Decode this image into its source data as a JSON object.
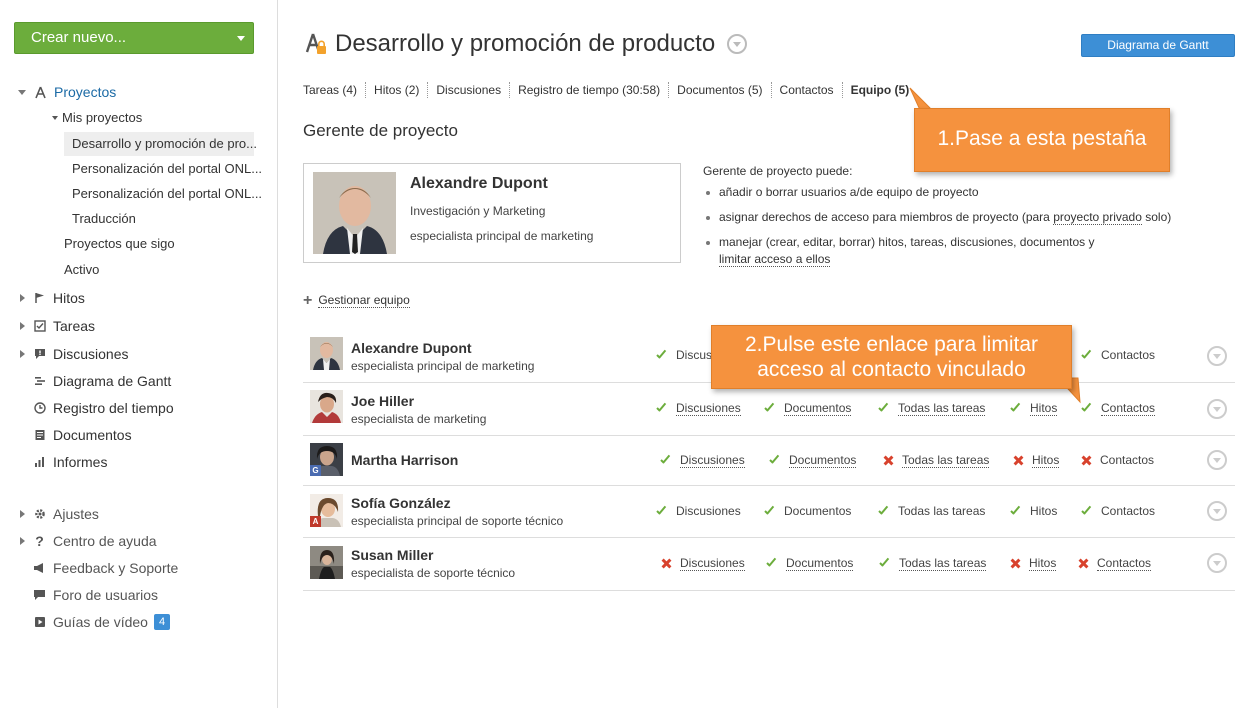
{
  "sidebar": {
    "create_label": "Crear nuevo...",
    "projects_label": "Proyectos",
    "my_projects_label": "Mis proyectos",
    "project_items": [
      "Desarrollo y promoción de pro...",
      "Personalización del portal ONL...",
      "Personalización del portal ONL...",
      "Traducción"
    ],
    "followed_label": "Proyectos que sigo",
    "active_label": "Activo",
    "milestones_label": "Hitos",
    "tasks_label": "Tareas",
    "discussions_label": "Discusiones",
    "gantt_label": "Diagrama de Gantt",
    "time_label": "Registro del tiempo",
    "documents_label": "Documentos",
    "reports_label": "Informes",
    "settings_label": "Ajustes",
    "help_label": "Centro de ayuda",
    "feedback_label": "Feedback y Soporte",
    "forum_label": "Foro de usuarios",
    "videos_label": "Guías de vídeo",
    "videos_badge": "4"
  },
  "header": {
    "title": "Desarrollo y promoción de producto",
    "gantt_button": "Diagrama de Gantt"
  },
  "tabs": [
    {
      "label": "Tareas (4)"
    },
    {
      "label": "Hitos (2)"
    },
    {
      "label": "Discusiones"
    },
    {
      "label": "Registro de tiempo (30:58)"
    },
    {
      "label": "Documentos (5)"
    },
    {
      "label": "Contactos"
    },
    {
      "label": "Equipo (5)"
    }
  ],
  "manager": {
    "heading": "Gerente de proyecto",
    "name": "Alexandre Dupont",
    "department": "Investigación y Marketing",
    "role": "especialista principal de marketing"
  },
  "rights": {
    "heading": "Gerente de proyecto puede:",
    "item1": "añadir o borrar usuarios a/de equipo de proyecto",
    "item2_pre": "asignar derechos de acceso para miembros de proyecto (para ",
    "item2_link": "proyecto privado",
    "item2_post": " solo)",
    "item3_pre": "manejar (crear, editar, borrar) hitos, tareas, discusiones, documentos y",
    "item3_link": "limitar acceso a ellos"
  },
  "manage_team": "Gestionar equipo",
  "team": [
    {
      "name": "Alexandre Dupont",
      "role": "especialista principal de marketing",
      "perms": {
        "disc": "Discusiones",
        "cont": "Contactos"
      }
    },
    {
      "name": "Joe Hiller",
      "role": "especialista de marketing",
      "perms": {
        "disc": "Discusiones",
        "docs": "Documentos",
        "tasks": "Todas las tareas",
        "hitos": "Hitos",
        "cont": "Contactos"
      }
    },
    {
      "name": "Martha Harrison",
      "role": "",
      "avatar_tag": "G",
      "perms": {
        "disc": "Discusiones",
        "docs": "Documentos",
        "tasks": "Todas las tareas",
        "hitos": "Hitos",
        "cont": "Contactos"
      }
    },
    {
      "name": "Sofía González",
      "role": "especialista principal de soporte técnico",
      "avatar_tag": "A",
      "perms": {
        "disc": "Discusiones",
        "docs": "Documentos",
        "tasks": "Todas las tareas",
        "hitos": "Hitos",
        "cont": "Contactos"
      }
    },
    {
      "name": "Susan Miller",
      "role": "especialista de soporte técnico",
      "perms": {
        "disc": "Discusiones",
        "docs": "Documentos",
        "tasks": "Todas las tareas",
        "hitos": "Hitos",
        "cont": "Contactos"
      }
    }
  ],
  "callouts": {
    "first": "1.Pase a esta pestaña",
    "second_line1": "2.Pulse este enlace para limitar",
    "second_line2": "acceso al contacto vinculado"
  },
  "colors": {
    "create_green": "#6cad3c",
    "accent_blue": "#3d8fd6",
    "callout_orange": "#f5923e",
    "allow_green": "#6cad3c",
    "deny_red": "#d8422d"
  }
}
